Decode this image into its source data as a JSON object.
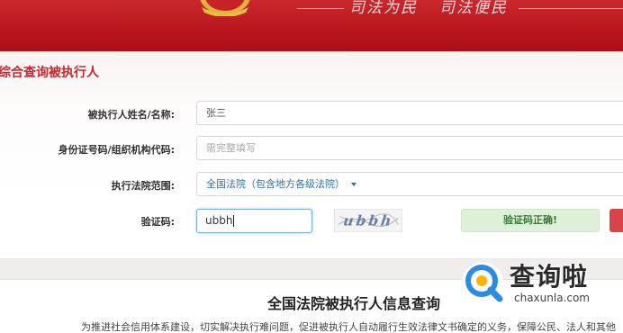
{
  "banner": {
    "slogan_left": "司法为民",
    "slogan_right": "司法便民"
  },
  "form": {
    "section_title": "综合查询被执行人",
    "name_label": "被执行人姓名/名称:",
    "name_value": "张三",
    "id_label": "身份证号码/组织机构代码:",
    "id_placeholder": "需完整填写",
    "court_label": "执行法院范围:",
    "court_value": "全国法院（包含地方各级法院）",
    "captcha_label": "验证码:",
    "captcha_value": "ubbh",
    "captcha_image_text": "ubbh",
    "verify_message": "验证码正确!"
  },
  "intro": {
    "title": "全国法院被执行人信息查询",
    "text": "为推进社会信用体系建设，切实解决执行难问题，促进被执行人自动履行生效法律文书确定的义务，保障公民、法人和其他"
  },
  "watermark": {
    "title": "查询啦",
    "domain": "chaxunla.com"
  },
  "colors": {
    "brand_red": "#b9171d",
    "title_red": "#c8262c",
    "link_blue": "#2f6fb3",
    "success_bg": "#dff0d8",
    "success_text": "#3c763d",
    "watermark_blue": "#2e8ce0"
  }
}
